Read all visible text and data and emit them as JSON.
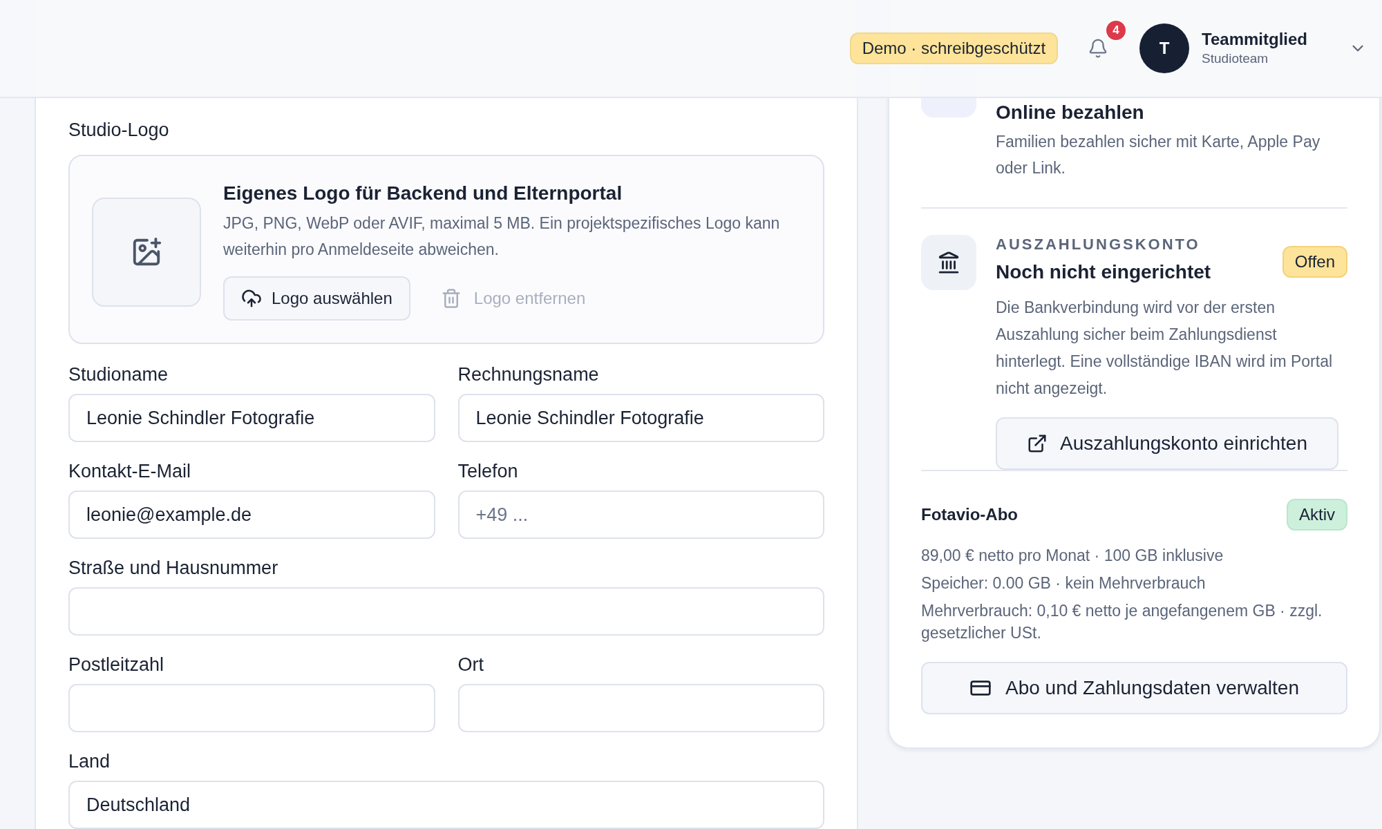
{
  "header": {
    "demo_badge": "Demo · schreibgeschützt",
    "notifications": {
      "count": "4"
    },
    "user": {
      "avatar_initial": "T",
      "name": "Teammitglied",
      "role": "Studioteam"
    }
  },
  "settings_form": {
    "logo_section": {
      "label": "Studio-Logo",
      "title": "Eigenes Logo für Backend und Elternportal",
      "description": "JPG, PNG, WebP oder AVIF, maximal 5 MB. Ein projektspezifisches Logo kann weiterhin pro Anmeldeseite abweichen.",
      "upload_button": "Logo auswählen",
      "remove_button": {
        "label": "Logo entfernen",
        "disabled": true
      }
    },
    "rows": [
      [
        {
          "label": "Studioname",
          "value": "Leonie Schindler Fotografie"
        },
        {
          "label": "Rechnungsname",
          "value": "Leonie Schindler Fotografie"
        }
      ],
      [
        {
          "label": "Kontakt-E-Mail",
          "value": "leonie@example.de"
        },
        {
          "label": "Telefon",
          "placeholder": "+49 ..."
        }
      ],
      [
        {
          "label": "Straße und Hausnummer"
        }
      ],
      [
        {
          "label": "Postleitzahl"
        },
        {
          "label": "Ort"
        }
      ],
      [
        {
          "label": "Land",
          "value": "Deutschland"
        }
      ]
    ]
  },
  "payments_panel": {
    "payment_method": {
      "title": "Online bezahlen",
      "description": "Familien bezahlen sicher mit Karte, Apple Pay oder Link."
    },
    "payout_account": {
      "label": "AUSZAHLUNGSKONTO",
      "title": "Noch nicht eingerichtet",
      "status": {
        "label": "Offen",
        "kind": "warning"
      },
      "description": "Die Bankverbindung wird vor der ersten Auszahlung sicher beim Zahlungsdienst hinterlegt. Eine vollständige IBAN wird im Portal nicht angezeigt.",
      "button": "Auszahlungskonto einrichten"
    },
    "subscription": {
      "title": "Fotavio-Abo",
      "status": {
        "label": "Aktiv",
        "kind": "success"
      },
      "details": [
        "89,00 € netto pro Monat · 100 GB inklusive",
        "Speicher: 0.00 GB · kein Mehrverbrauch",
        "Mehrverbrauch: 0,10 € netto je angefangenem GB · zzgl. gesetzlicher USt."
      ],
      "button": "Abo und Zahlungsdaten verwalten"
    }
  }
}
